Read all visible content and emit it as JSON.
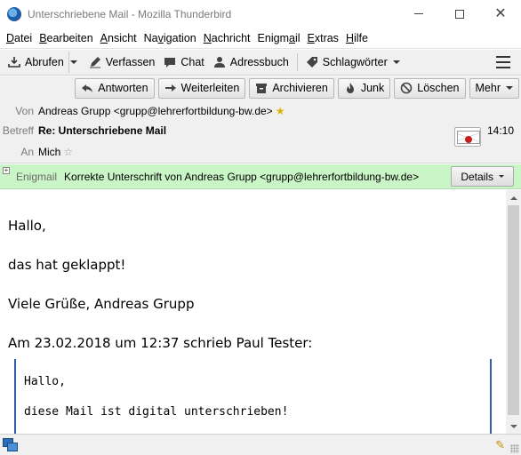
{
  "window": {
    "title": "Unterschriebene Mail - Mozilla Thunderbird",
    "icon": "thunderbird-app-icon"
  },
  "menubar": {
    "items": [
      {
        "label": "Datei",
        "accel_index": 0
      },
      {
        "label": "Bearbeiten",
        "accel_index": 0
      },
      {
        "label": "Ansicht",
        "accel_index": 0
      },
      {
        "label": "Navigation",
        "accel_index": 2
      },
      {
        "label": "Nachricht",
        "accel_index": 0
      },
      {
        "label": "Enigmail",
        "accel_index": 5
      },
      {
        "label": "Extras",
        "accel_index": 0
      },
      {
        "label": "Hilfe",
        "accel_index": 0
      }
    ]
  },
  "toolbar": {
    "abrufen": "Abrufen",
    "verfassen": "Verfassen",
    "chat": "Chat",
    "adressbuch": "Adressbuch",
    "schlagwoerter": "Schlagwörter"
  },
  "message_actions": {
    "antworten": "Antworten",
    "weiterleiten": "Weiterleiten",
    "archivieren": "Archivieren",
    "junk": "Junk",
    "loeschen": "Löschen",
    "mehr": "Mehr"
  },
  "header": {
    "from_label": "Von",
    "from_value": "Andreas Grupp <grupp@lehrerfortbildung-bw.de>",
    "subject_label": "Betreff",
    "subject_value": "Re: Unterschriebene Mail",
    "to_label": "An",
    "to_value": "Mich",
    "time": "14:10"
  },
  "enigmail": {
    "label": "Enigmail",
    "message": "Korrekte Unterschrift von Andreas Grupp <grupp@lehrerfortbildung-bw.de>",
    "details_button": "Details",
    "bar_color": "#caf5c7"
  },
  "body": {
    "lines": [
      "Hallo,",
      "das hat geklappt!",
      "Viele Grüße, Andreas Grupp",
      "Am 23.02.2018 um 12:37 schrieb Paul Tester:"
    ],
    "quote": [
      "Hallo,",
      "diese Mail ist digital unterschrieben!"
    ]
  },
  "colors": {
    "quote_bar": "#2a5ea8",
    "star_filled": "#e0b000"
  }
}
